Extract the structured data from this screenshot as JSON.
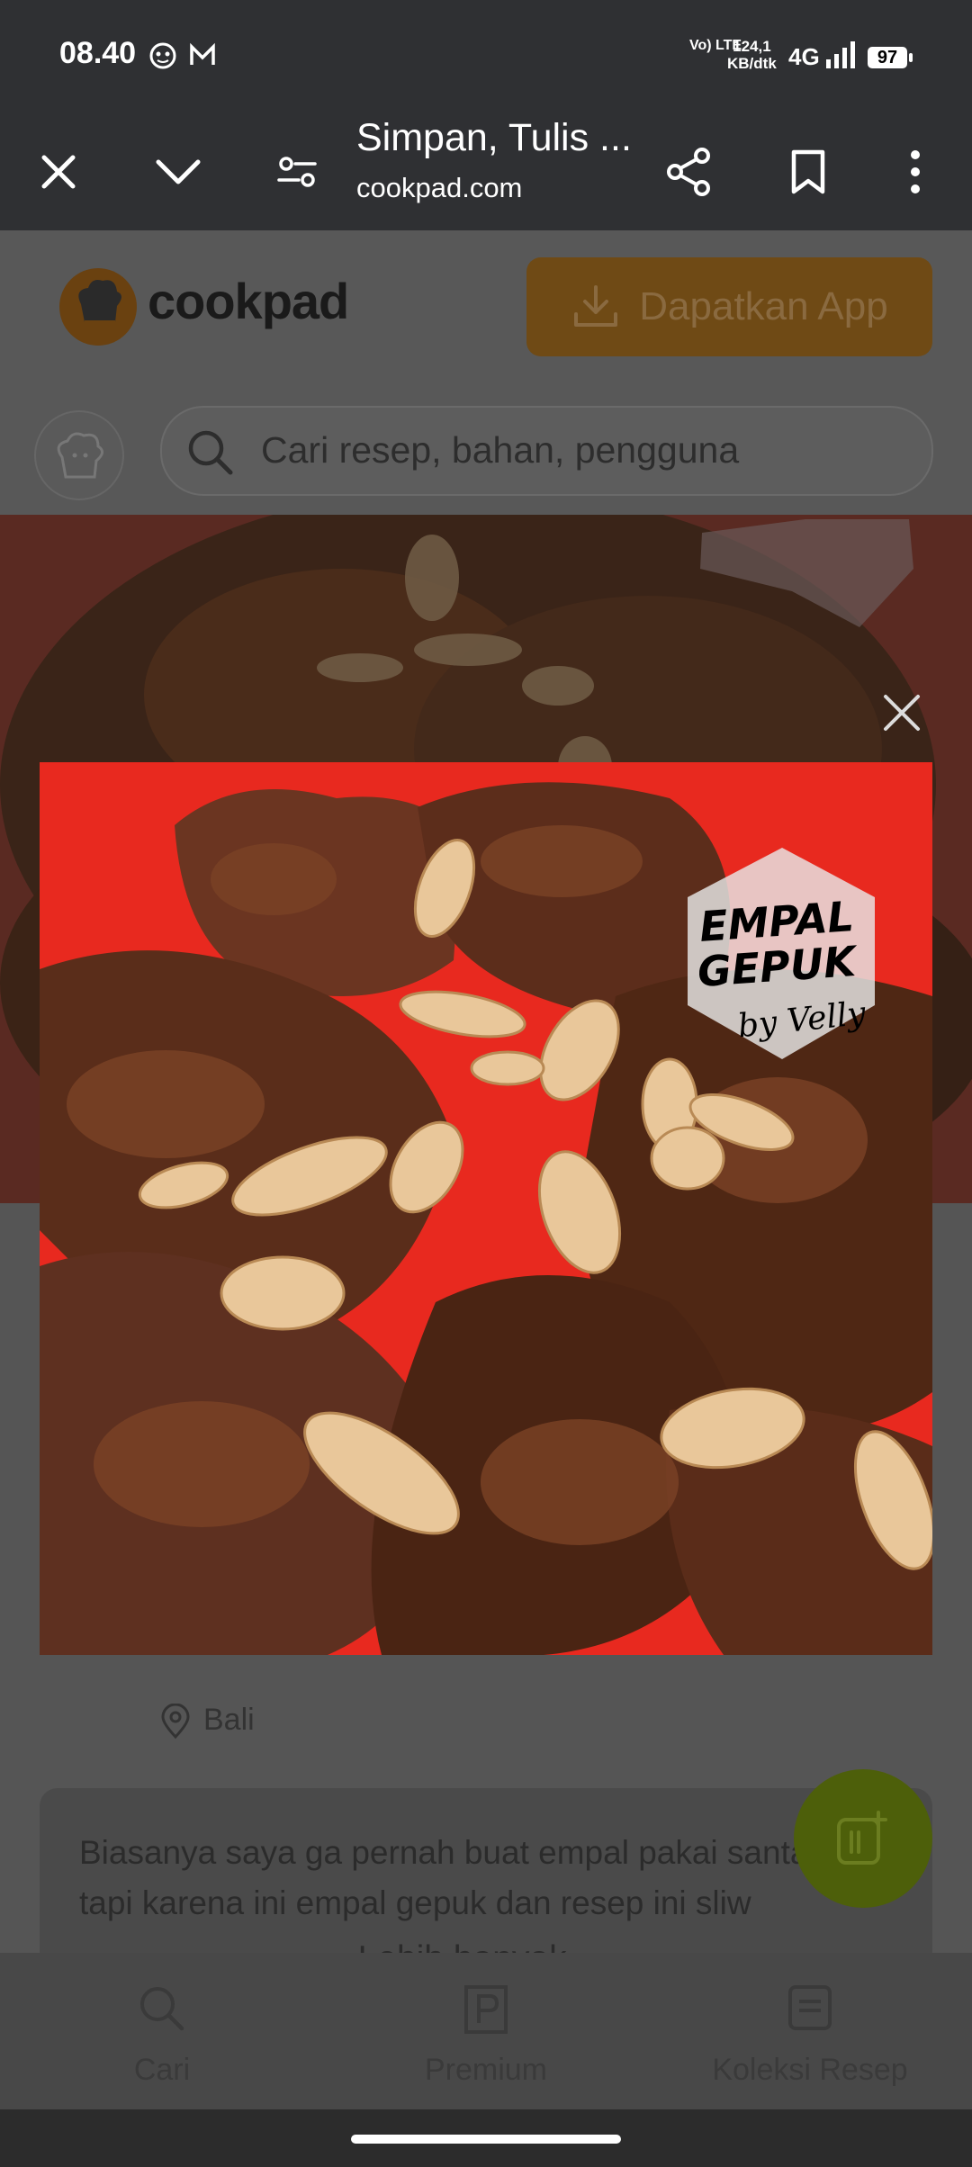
{
  "status_bar": {
    "time": "08.40",
    "network_label": "Vo) LTE",
    "speed_value": "124,1",
    "speed_unit": "KB/dtk",
    "network_type": "4G",
    "battery": "97"
  },
  "toolbar": {
    "page_title": "Simpan, Tulis ...",
    "page_url": "cookpad.com"
  },
  "header": {
    "brand": "cookpad",
    "app_button_label": "Dapatkan App",
    "search_placeholder": "Cari resep, bahan, pengguna"
  },
  "recipe": {
    "image_label_line1": "EMPAL",
    "image_label_line2": "GEPUK",
    "image_label_by": "by Velly",
    "location": "Bali",
    "description": "Biasanya saya ga pernah buat empal pakai santan tapi karena ini empal gepuk dan resep ini sliw",
    "more_label": "Lebih banyak"
  },
  "bottom_nav": {
    "items": [
      {
        "label": "Cari",
        "icon": "search-icon"
      },
      {
        "label": "Premium",
        "icon": "premium-icon"
      },
      {
        "label": "Koleksi Resep",
        "icon": "collection-icon"
      }
    ]
  },
  "colors": {
    "status_bar_bg": "#2f3033",
    "dim_overlay": "#555555",
    "brand_orange": "#f0a33a",
    "accent_green": "#8bc34a",
    "photo_red": "#e8291f"
  }
}
